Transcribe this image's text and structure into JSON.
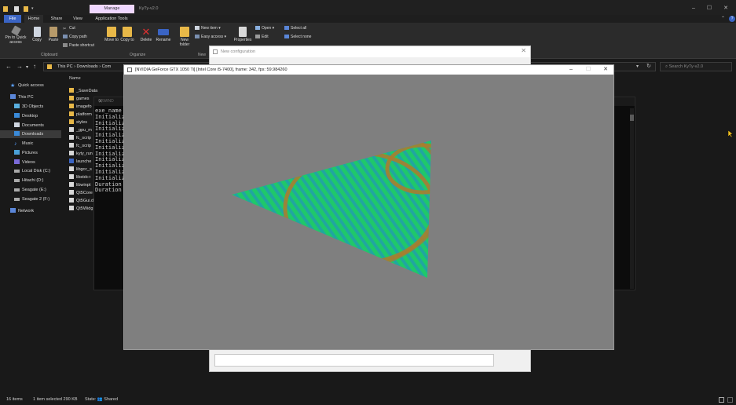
{
  "window": {
    "manage_tab": "Manage",
    "title": "KyTy-v2.0",
    "minimize": "–",
    "maximize": "☐",
    "close": "✕"
  },
  "tabs": [
    "File",
    "Home",
    "Share",
    "View",
    "Application Tools"
  ],
  "ribbon": {
    "clipboard": {
      "pin_label": "Pin to Quick access",
      "copy_label": "Copy",
      "paste_label": "Paste",
      "cut_label": "Cut",
      "copy_path_label": "Copy path",
      "paste_shortcut_label": "Paste shortcut",
      "group_label": "Clipboard"
    },
    "organize": {
      "move_to_label": "Move to",
      "copy_to_label": "Copy to",
      "delete_label": "Delete",
      "rename_label": "Rename",
      "group_label": "Organize"
    },
    "new": {
      "new_folder_label": "New folder",
      "new_item_label": "New item",
      "easy_access_label": "Easy access",
      "group_label": "New"
    },
    "open": {
      "properties_label": "Properties",
      "open_label": "Open",
      "edit_label": "Edit"
    },
    "select": {
      "select_all_label": "Select all",
      "select_none_label": "Select none"
    }
  },
  "address": {
    "crumbs": [
      "This PC",
      "Downloads",
      "Com"
    ],
    "search_placeholder": "Search KyTy-v2.0"
  },
  "navpane": {
    "quick_access": "Quick access",
    "this_pc": "This PC",
    "objects_3d": "3D Objects",
    "desktop": "Desktop",
    "documents": "Documents",
    "downloads": "Downloads",
    "music": "Music",
    "pictures": "Pictures",
    "videos": "Videos",
    "local_disk": "Local Disk (C:)",
    "hitachi": "Hitachi (D:)",
    "seagate_e": "Seagate (E:)",
    "seagate2_f": "Seagate 2 (F:)",
    "network": "Network"
  },
  "filelist": {
    "column_name": "Name",
    "items": [
      {
        "name": "_SaveData",
        "kind": "folder"
      },
      {
        "name": "games",
        "kind": "folder"
      },
      {
        "name": "imagefo",
        "kind": "folder"
      },
      {
        "name": "platform",
        "kind": "folder"
      },
      {
        "name": "styles",
        "kind": "folder"
      },
      {
        "name": "_gpu_m",
        "kind": "file"
      },
      {
        "name": "fc_scrip",
        "kind": "file"
      },
      {
        "name": "fc_scrip",
        "kind": "file"
      },
      {
        "name": "kyty_run",
        "kind": "file"
      },
      {
        "name": "launche",
        "kind": "file"
      },
      {
        "name": "libgcc_s",
        "kind": "file"
      },
      {
        "name": "libstdc+",
        "kind": "file"
      },
      {
        "name": "libwinpt",
        "kind": "file"
      },
      {
        "name": "Qt5Core",
        "kind": "file"
      },
      {
        "name": "Qt5Gui.d",
        "kind": "file"
      },
      {
        "name": "Qt5Widg",
        "kind": "file"
      }
    ]
  },
  "console": {
    "title": "C:\\WIND",
    "lines": [
      "exe_name =",
      "Initialize",
      "Initialize",
      "Initialize",
      "Initialize",
      "Initialize",
      "Initialize",
      "Initialize",
      "Initialize",
      "Initialize",
      "Initialize",
      "Initialize",
      "Duration -",
      "Duration -"
    ]
  },
  "new_config_dialog": {
    "title": "New configuration",
    "close": "✕"
  },
  "gpu_window": {
    "title": "[NVIDIA GeForce GTX 1050 Ti] [Intel Core i5-7400], frame: 342, fps: 59.984260",
    "minimize": "–",
    "maximize": "☐",
    "close": "✕"
  },
  "statusbar": {
    "items_count": "16 items",
    "selected": "1 item selected  290 KB",
    "state": "State: 👥 Shared"
  },
  "colors": {
    "accent": "#3a64c4",
    "manage": "#efd7ff",
    "render_bg": "#7f7f7f",
    "triangle_green": "#1fc86a",
    "triangle_teal": "#21a6a0",
    "triangle_orange": "#b07a2a"
  }
}
